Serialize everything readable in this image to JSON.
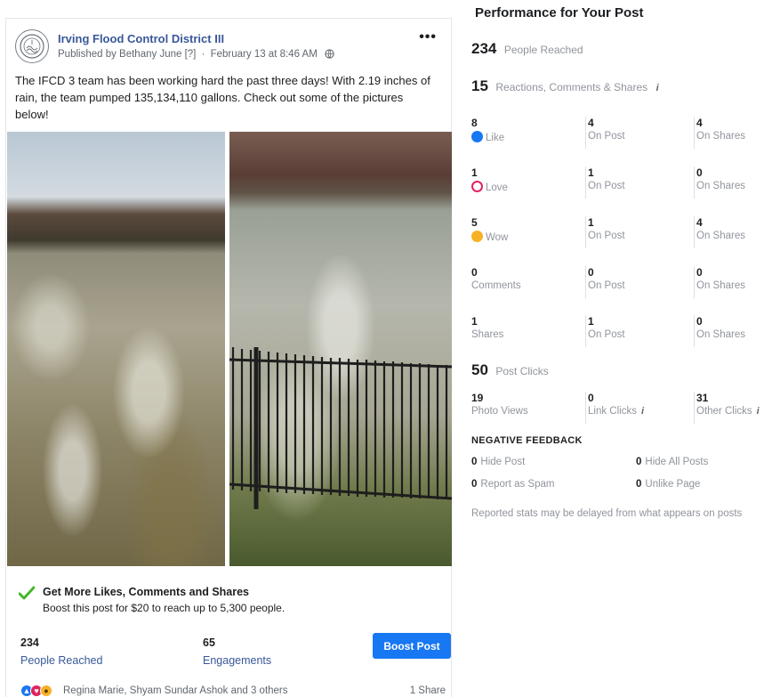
{
  "post": {
    "page_name": "Irving Flood Control District III",
    "published_by": "Published by Bethany June [?]",
    "date": "February 13 at 8:46 AM",
    "more": "•••",
    "text": "The IFCD 3 team has been working hard the past three days! With 2.19 inches of rain, the team pumped 135,134,110 gallons. Check out some of the pictures below!",
    "boost": {
      "title": "Get More Likes, Comments and Shares",
      "subtitle": "Boost this post for $20 to reach up to 5,300 people."
    },
    "stats": {
      "reached_value": "234",
      "reached_label": "People Reached",
      "engagements_value": "65",
      "engagements_label": "Engagements",
      "boost_button": "Boost Post"
    },
    "footer": {
      "reactors": "Regina Marie, Shyam Sundar Ashok and 3 others",
      "shares": "1 Share"
    }
  },
  "performance": {
    "title": "Performance for Your Post",
    "people_reached": {
      "value": "234",
      "label": "People Reached"
    },
    "reactions_total": {
      "value": "15",
      "label": "Reactions, Comments & Shares"
    },
    "rows": [
      {
        "total": "8",
        "label": "Like",
        "on_post": "4",
        "on_shares": "4"
      },
      {
        "total": "1",
        "label": "Love",
        "on_post": "1",
        "on_shares": "0"
      },
      {
        "total": "5",
        "label": "Wow",
        "on_post": "1",
        "on_shares": "4"
      },
      {
        "total": "0",
        "label": "Comments",
        "on_post": "0",
        "on_shares": "0"
      },
      {
        "total": "1",
        "label": "Shares",
        "on_post": "1",
        "on_shares": "0"
      }
    ],
    "on_post_label": "On Post",
    "on_shares_label": "On Shares",
    "post_clicks": {
      "value": "50",
      "label": "Post Clicks"
    },
    "clicks": {
      "photo_views": {
        "value": "19",
        "label": "Photo Views"
      },
      "link_clicks": {
        "value": "0",
        "label": "Link Clicks"
      },
      "other_clicks": {
        "value": "31",
        "label": "Other Clicks"
      }
    },
    "negative": {
      "title": "NEGATIVE FEEDBACK",
      "hide_post": {
        "value": "0",
        "label": "Hide Post"
      },
      "hide_all": {
        "value": "0",
        "label": "Hide All Posts"
      },
      "spam": {
        "value": "0",
        "label": "Report as Spam"
      },
      "unlike": {
        "value": "0",
        "label": "Unlike Page"
      }
    },
    "note": "Reported stats may be delayed from what appears on posts"
  },
  "colors": {
    "link_blue": "#385898",
    "button_blue": "#1877f2",
    "muted_gray": "#90949c",
    "love_red": "#e0245e",
    "wow_yellow": "#f7b125",
    "check_green": "#42b72a"
  },
  "icons": {
    "avatar": "district-seal-icon",
    "privacy": "globe-icon",
    "boost": "check-icon",
    "info": "info-icon"
  }
}
